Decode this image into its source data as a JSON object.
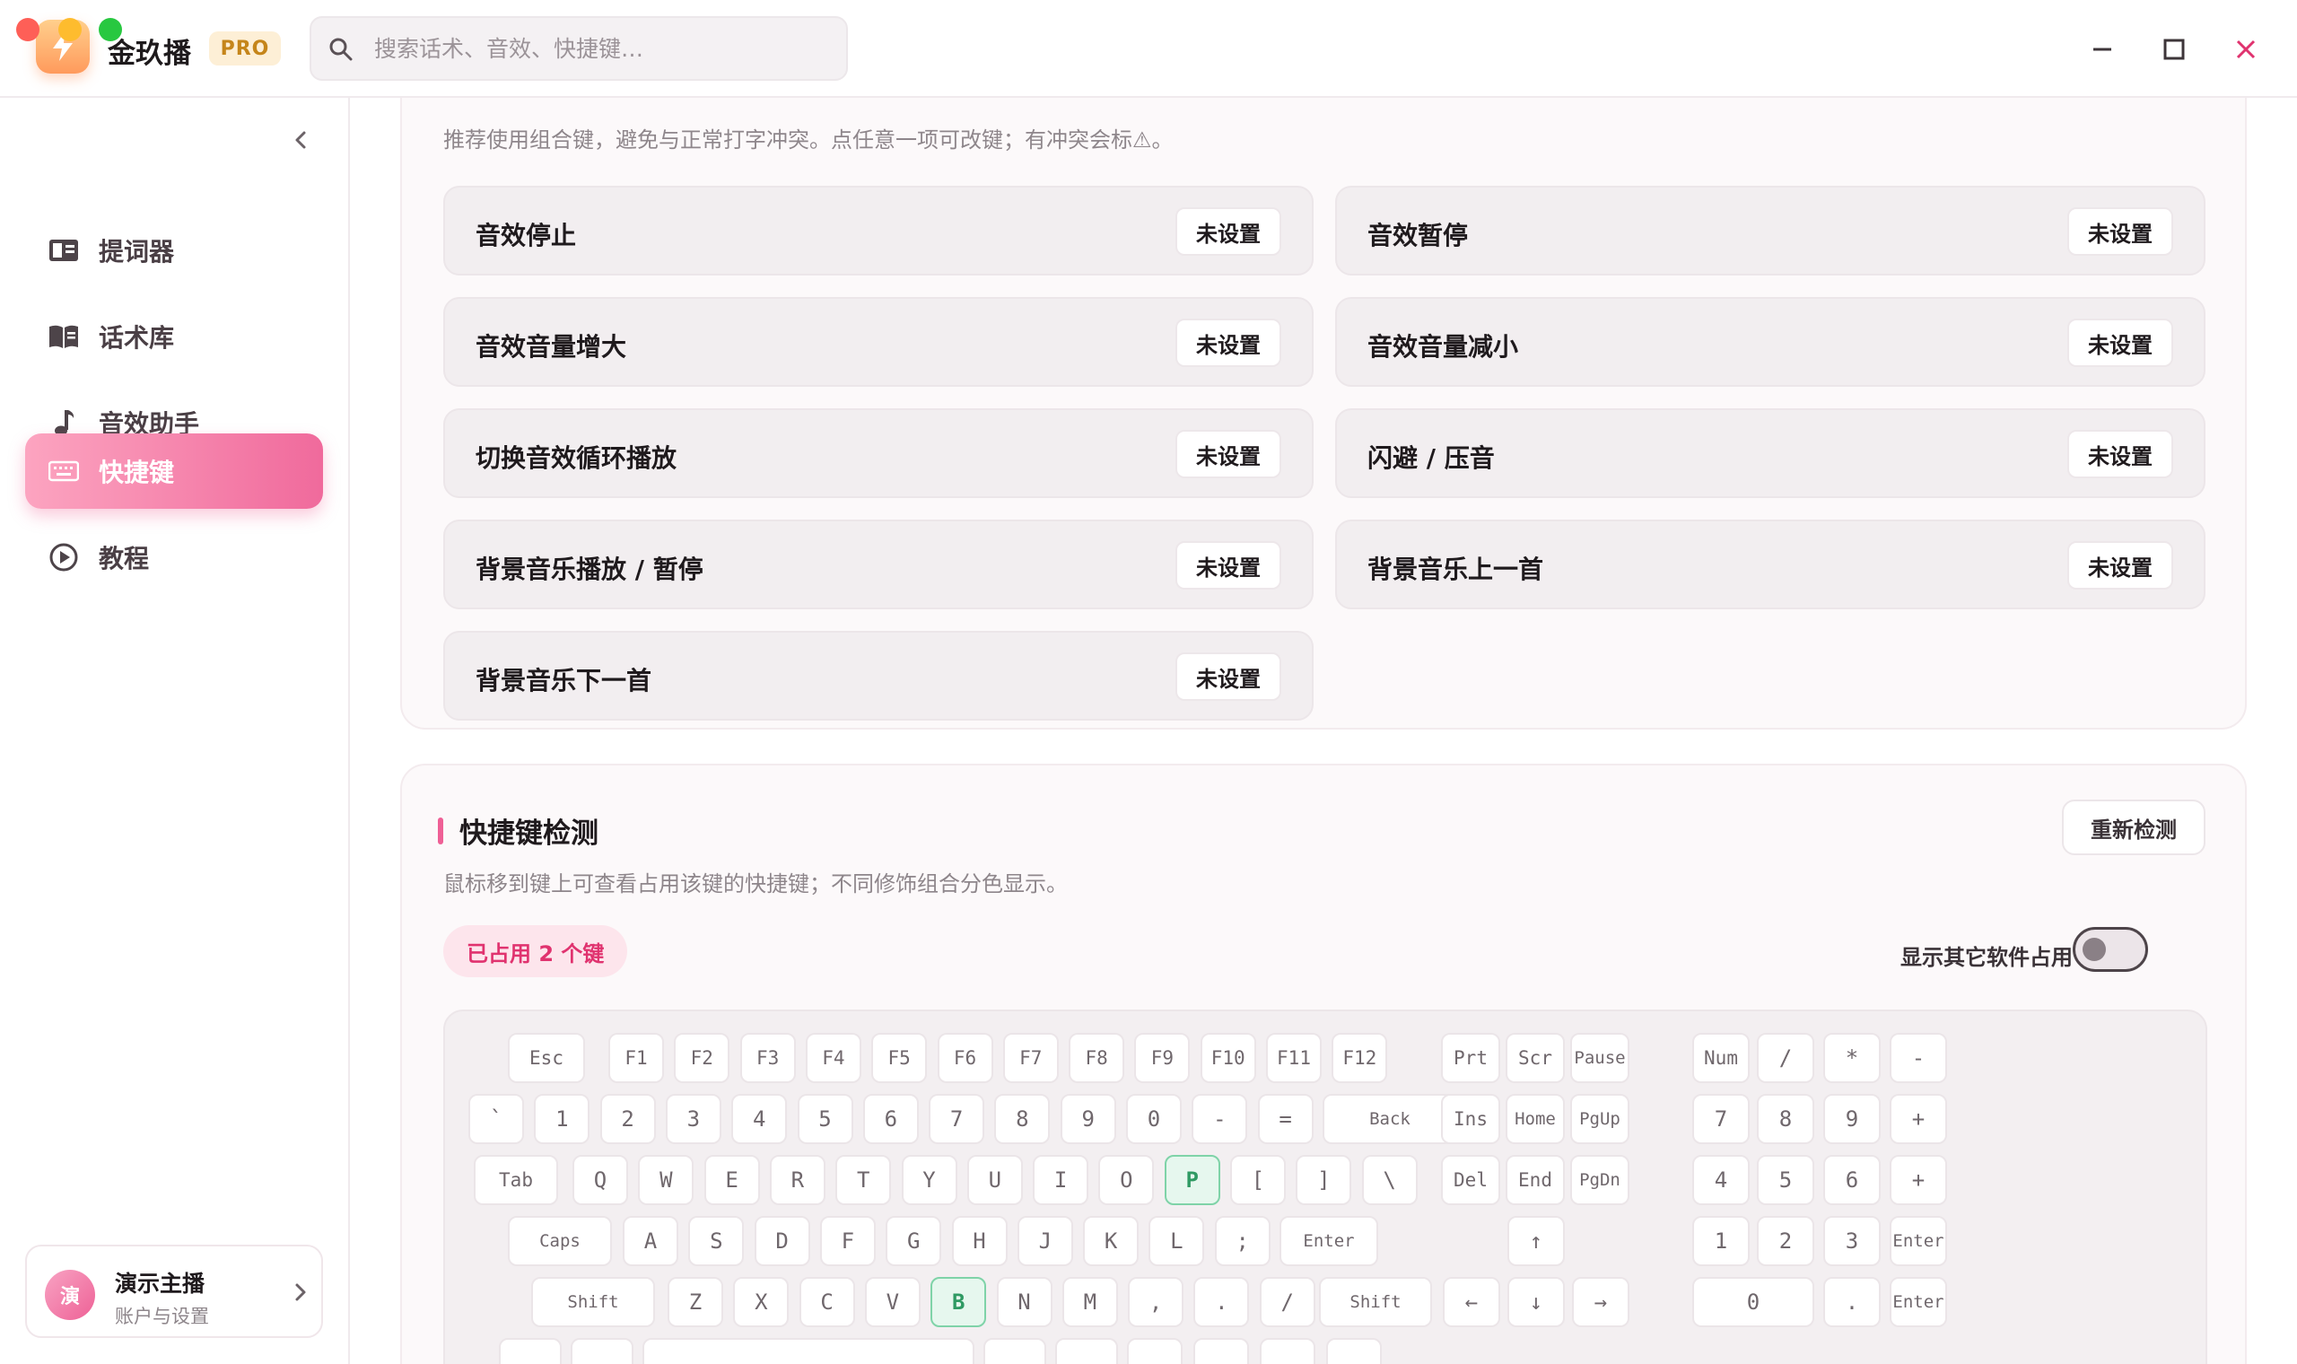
{
  "app": {
    "name": "金玖播",
    "badge": "PRO"
  },
  "search": {
    "placeholder": "搜索话术、音效、快捷键…"
  },
  "sidebar": {
    "items": [
      {
        "label": "提词器",
        "icon": "teleprompter-icon"
      },
      {
        "label": "话术库",
        "icon": "book-icon"
      },
      {
        "label": "音效助手",
        "icon": "music-note-icon"
      },
      {
        "label": "快捷键",
        "icon": "keyboard-icon",
        "active": true
      },
      {
        "label": "教程",
        "icon": "play-circle-icon"
      }
    ],
    "user": {
      "avatar_text": "演",
      "name": "演示主播",
      "subtitle": "账户与设置"
    }
  },
  "shortcuts": {
    "hint": "推荐使用组合键，避免与正常打字冲突。点任意一项可改键；有冲突会标⚠。",
    "unset_label": "未设置",
    "items": [
      {
        "label": "音效停止",
        "value": "未设置"
      },
      {
        "label": "音效暂停",
        "value": "未设置"
      },
      {
        "label": "音效音量增大",
        "value": "未设置"
      },
      {
        "label": "音效音量减小",
        "value": "未设置"
      },
      {
        "label": "切换音效循环播放",
        "value": "未设置"
      },
      {
        "label": "闪避 / 压音",
        "value": "未设置"
      },
      {
        "label": "背景音乐播放 / 暂停",
        "value": "未设置"
      },
      {
        "label": "背景音乐上一首",
        "value": "未设置"
      },
      {
        "label": "背景音乐下一首",
        "value": "未设置"
      }
    ]
  },
  "detect": {
    "title": "快捷键检测",
    "redetect_label": "重新检测",
    "hint": "鼠标移到键上可查看占用该键的快捷键；不同修饰组合分色显示。",
    "occupied_label": "已占用 2 个键",
    "toggle_label": "显示其它软件占用",
    "toggle_on": false,
    "used_keys": [
      "P",
      "B"
    ],
    "keyboard": {
      "fn_row": [
        "Esc",
        "F1",
        "F2",
        "F3",
        "F4",
        "F5",
        "F6",
        "F7",
        "F8",
        "F9",
        "F10",
        "F11",
        "F12"
      ],
      "num_row": [
        "`",
        "1",
        "2",
        "3",
        "4",
        "5",
        "6",
        "7",
        "8",
        "9",
        "0",
        "-",
        "=",
        "Back"
      ],
      "tab_row": [
        "Tab",
        "Q",
        "W",
        "E",
        "R",
        "T",
        "Y",
        "U",
        "I",
        "O",
        "P",
        "[",
        "]",
        "\\"
      ],
      "caps_row": [
        "Caps",
        "A",
        "S",
        "D",
        "F",
        "G",
        "H",
        "J",
        "K",
        "L",
        ";",
        "Enter"
      ],
      "shift_row": [
        "Shift",
        "Z",
        "X",
        "C",
        "V",
        "B",
        "N",
        "M",
        ",",
        ".",
        "/",
        "Shift"
      ],
      "nav_top": [
        "Prt",
        "Scr",
        "Pause"
      ],
      "nav_mid1": [
        "Ins",
        "Home",
        "PgUp"
      ],
      "nav_mid2": [
        "Del",
        "End",
        "PgDn"
      ],
      "arrows": [
        "↑",
        "←",
        "↓",
        "→"
      ],
      "numpad": [
        [
          "Num",
          "/",
          "*",
          "-"
        ],
        [
          "7",
          "8",
          "9",
          "+"
        ],
        [
          "4",
          "5",
          "6",
          "+"
        ],
        [
          "1",
          "2",
          "3",
          "Enter"
        ],
        [
          "0",
          ".",
          "Enter"
        ]
      ]
    }
  }
}
